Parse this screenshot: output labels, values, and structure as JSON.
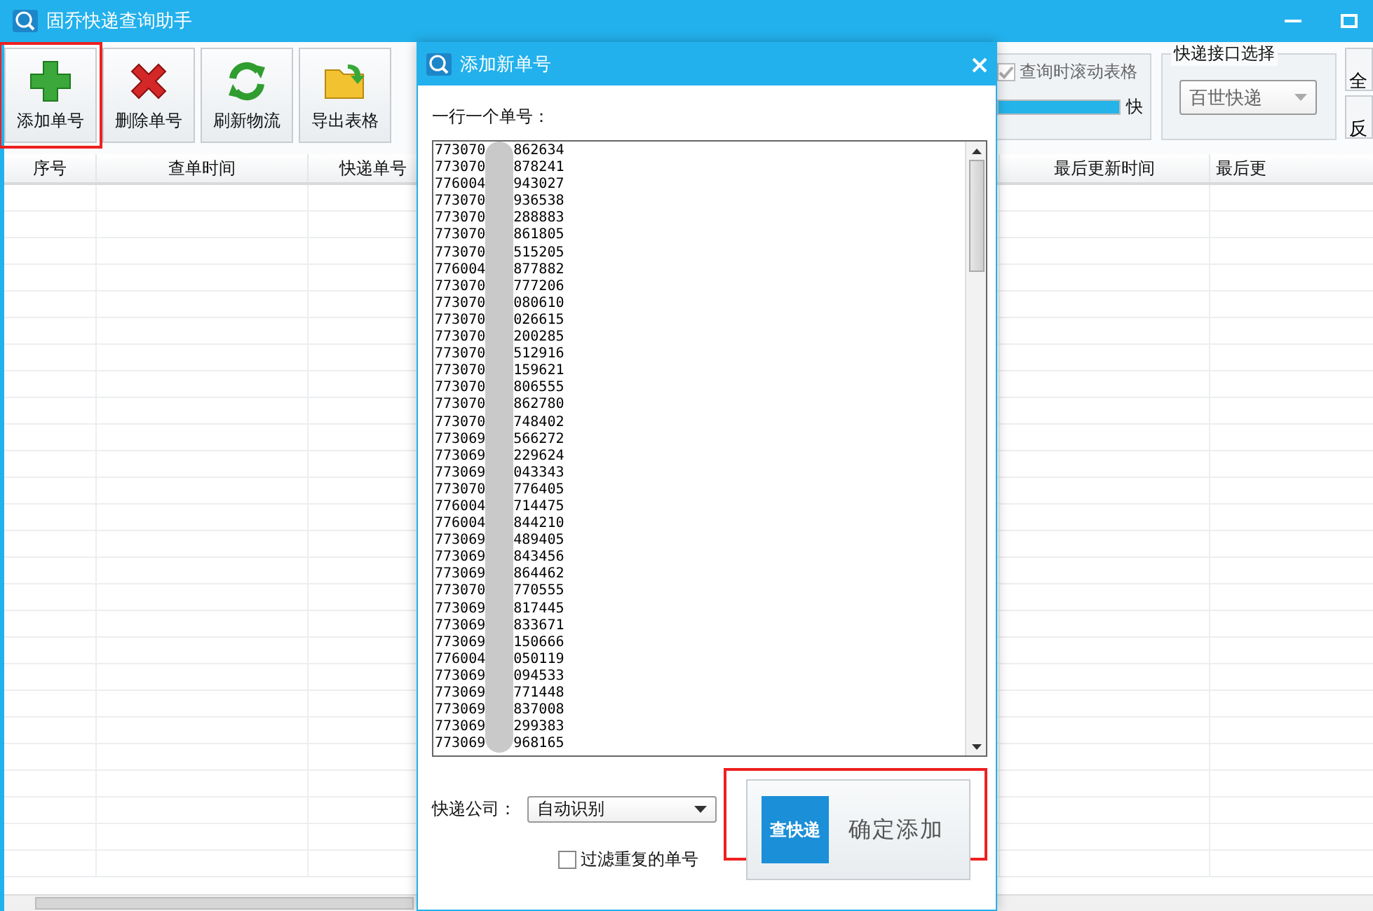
{
  "window": {
    "title": "固乔快递查询助手"
  },
  "toolbar": [
    {
      "label": "添加单号",
      "kind": "add",
      "highlighted": true
    },
    {
      "label": "删除单号",
      "kind": "delete",
      "highlighted": false
    },
    {
      "label": "刷新物流",
      "kind": "refresh",
      "highlighted": false
    },
    {
      "label": "导出表格",
      "kind": "export",
      "highlighted": false
    }
  ],
  "options_group": {
    "checkbox": {
      "label": "查询时滚动表格",
      "checked": true
    },
    "speed": {
      "level": 1,
      "label": "快"
    }
  },
  "api_group": {
    "legend": "快递接口选择",
    "select": {
      "value": "百世快递"
    }
  },
  "side_buttons": [
    "全",
    "反"
  ],
  "table": {
    "columns": [
      "序号",
      "查单时间",
      "快递单号",
      "最后更新时间",
      "最后更"
    ]
  },
  "dialog": {
    "title": "添加新单号",
    "prompt": "一行一个单号：",
    "numbers": [
      {
        "start": "773070",
        "end": "862634"
      },
      {
        "start": "773070",
        "end": "878241"
      },
      {
        "start": "776004",
        "end": "943027"
      },
      {
        "start": "773070",
        "end": "936538"
      },
      {
        "start": "773070",
        "end": "288883"
      },
      {
        "start": "773070",
        "end": "861805"
      },
      {
        "start": "773070",
        "end": "515205"
      },
      {
        "start": "776004",
        "end": "877882"
      },
      {
        "start": "773070",
        "end": "777206"
      },
      {
        "start": "773070",
        "end": "080610"
      },
      {
        "start": "773070",
        "end": "026615"
      },
      {
        "start": "773070",
        "end": "200285"
      },
      {
        "start": "773070",
        "end": "512916"
      },
      {
        "start": "773070",
        "end": "159621"
      },
      {
        "start": "773070",
        "end": "806555"
      },
      {
        "start": "773070",
        "end": "862780"
      },
      {
        "start": "773070",
        "end": "748402"
      },
      {
        "start": "773069",
        "end": "566272"
      },
      {
        "start": "773069",
        "end": "229624"
      },
      {
        "start": "773069",
        "end": "043343"
      },
      {
        "start": "773070",
        "end": "776405"
      },
      {
        "start": "776004",
        "end": "714475"
      },
      {
        "start": "776004",
        "end": "844210"
      },
      {
        "start": "773069",
        "end": "489405"
      },
      {
        "start": "773069",
        "end": "843456"
      },
      {
        "start": "773069",
        "end": "864462"
      },
      {
        "start": "773070",
        "end": "770555"
      },
      {
        "start": "773069",
        "end": "817445"
      },
      {
        "start": "773069",
        "end": "833671"
      },
      {
        "start": "773069",
        "end": "150666"
      },
      {
        "start": "776004",
        "end": "050119"
      },
      {
        "start": "773069",
        "end": "094533"
      },
      {
        "start": "773069",
        "end": "771448"
      },
      {
        "start": "773069",
        "end": "837008"
      },
      {
        "start": "773069",
        "end": "299383"
      },
      {
        "start": "773069",
        "end": "968165"
      }
    ],
    "company_label": "快递公司：",
    "company_select": {
      "value": "自动识别"
    },
    "filter": {
      "label": "过滤重复的单号",
      "checked": false
    },
    "confirm": {
      "badge": "查快递",
      "label": "确定添加",
      "highlighted": true
    }
  }
}
